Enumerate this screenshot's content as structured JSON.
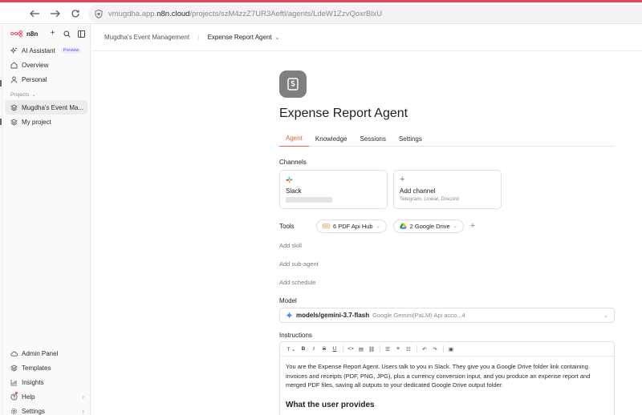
{
  "browser": {
    "url_prefix": "vmugdha.app.",
    "url_domain": "n8n.cloud",
    "url_path": "/projects/szM4zzZ7UR3Aeftl/agents/LdeW1ZzvQoxrBlxU"
  },
  "sidebar": {
    "brand": "n8n",
    "items": [
      {
        "label": "AI Assistant",
        "badge": "Preview",
        "icon": "sparkle-icon"
      },
      {
        "label": "Overview",
        "icon": "home-icon"
      },
      {
        "label": "Personal",
        "icon": "user-icon"
      }
    ],
    "projects_label": "Projects",
    "projects": [
      {
        "label": "Mugdha's Event Ma...",
        "active": true
      },
      {
        "label": "My project",
        "active": false
      }
    ],
    "bottom": [
      {
        "label": "Admin Panel",
        "icon": "cloud-icon"
      },
      {
        "label": "Templates",
        "icon": "templates-icon"
      },
      {
        "label": "Insights",
        "icon": "chart-icon"
      },
      {
        "label": "Help",
        "icon": "help-icon",
        "chevron": true
      },
      {
        "label": "Settings",
        "icon": "gear-icon",
        "chevron": true
      }
    ]
  },
  "header": {
    "project": "Mugdha's Event Management",
    "agent": "Expense Report Agent"
  },
  "agent": {
    "title": "Expense Report Agent",
    "tabs": [
      "Agent",
      "Knowledge",
      "Sessions",
      "Settings"
    ],
    "active_tab": "Agent"
  },
  "channels": {
    "label": "Channels",
    "slack": {
      "name": "Slack"
    },
    "add": {
      "name": "Add channel",
      "sub": "Telegram, Linear, Discord"
    }
  },
  "tools": {
    "label": "Tools",
    "pills": [
      {
        "label": "6 PDF Api Hub",
        "icon": "pdf-api-hub-icon"
      },
      {
        "label": "2 Google Drive",
        "icon": "google-drive-icon"
      }
    ]
  },
  "links": {
    "skill": "Add skill",
    "subagent": "Add sub-agent",
    "schedule": "Add schedule"
  },
  "model": {
    "label": "Model",
    "name": "models/gemini-3.7-flash",
    "credential": "Google Gemini(PaLM) Api acco...4"
  },
  "instructions": {
    "label": "Instructions",
    "body": "You are the Expense Report Agent. Users talk to you in Slack. They give you a Google Drive folder link containing invoices and receipts (PDF, PNG, JPG), plus a currency conversion input, and you produce an expense report and merged PDF files, saving all outputs to your dedicated Google Drive output folder.",
    "heading": "What the user provides"
  },
  "colors": {
    "accent": "#e8613a",
    "top_strip": "#e4455b",
    "avatar_bg": "#7f7f7f",
    "preview_badge": "#6b4fd6"
  }
}
